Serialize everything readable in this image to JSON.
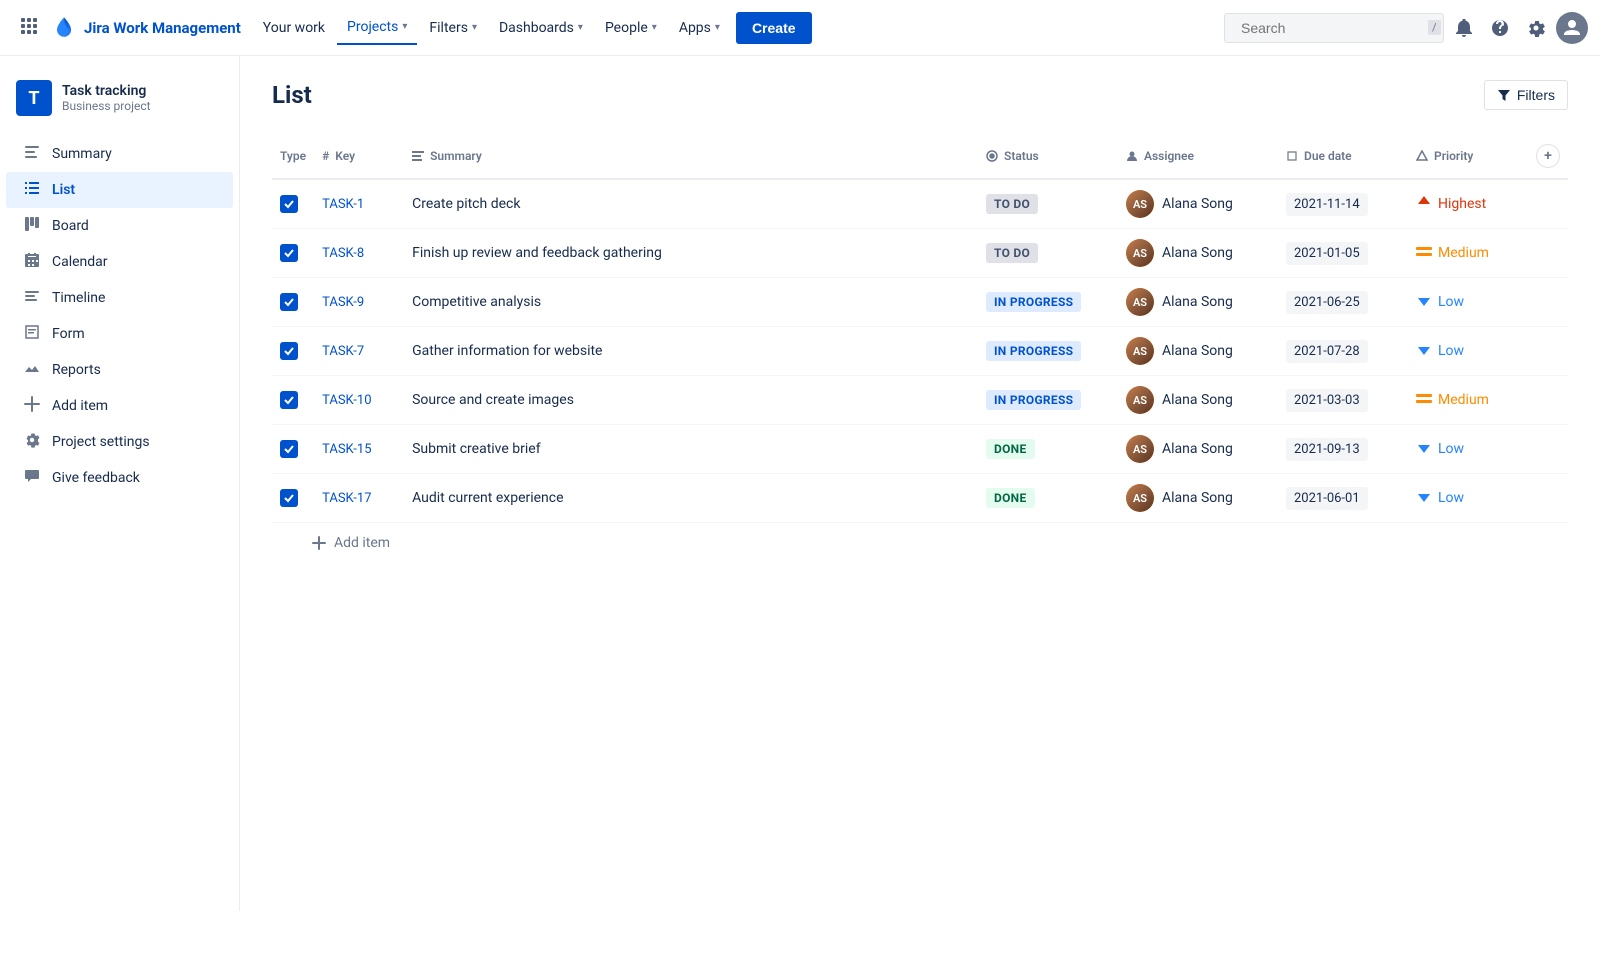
{
  "topnav": {
    "logo_text": "Jira Work Management",
    "your_work": "Your work",
    "projects": "Projects",
    "filters": "Filters",
    "dashboards": "Dashboards",
    "people": "People",
    "apps": "Apps",
    "create": "Create",
    "search_placeholder": "Search",
    "search_shortcut": "/"
  },
  "sidebar": {
    "project_name": "Task tracking",
    "project_type": "Business project",
    "items": [
      {
        "id": "summary",
        "label": "Summary",
        "icon": "▤"
      },
      {
        "id": "list",
        "label": "List",
        "icon": "≡"
      },
      {
        "id": "board",
        "label": "Board",
        "icon": "⊞"
      },
      {
        "id": "calendar",
        "label": "Calendar",
        "icon": "📅"
      },
      {
        "id": "timeline",
        "label": "Timeline",
        "icon": "⊟"
      },
      {
        "id": "form",
        "label": "Form",
        "icon": "📋"
      },
      {
        "id": "reports",
        "label": "Reports",
        "icon": "📈"
      },
      {
        "id": "add-item",
        "label": "Add item",
        "icon": "＋"
      },
      {
        "id": "project-settings",
        "label": "Project settings",
        "icon": "⚙"
      },
      {
        "id": "give-feedback",
        "label": "Give feedback",
        "icon": "📢"
      }
    ]
  },
  "main": {
    "page_title": "List",
    "filters_label": "Filters",
    "columns": [
      {
        "id": "type",
        "label": "Type"
      },
      {
        "id": "key",
        "label": "Key",
        "icon": "#"
      },
      {
        "id": "summary",
        "label": "Summary",
        "icon": "≡"
      },
      {
        "id": "status",
        "label": "Status",
        "icon": "⊙"
      },
      {
        "id": "assignee",
        "label": "Assignee",
        "icon": "@"
      },
      {
        "id": "duedate",
        "label": "Due date",
        "icon": "🏷"
      },
      {
        "id": "priority",
        "label": "Priority",
        "icon": "⊙"
      }
    ],
    "tasks": [
      {
        "key": "TASK-1",
        "summary": "Create pitch deck",
        "status": "TO DO",
        "status_type": "todo",
        "assignee": "Alana Song",
        "due_date": "2021-11-14",
        "priority": "Highest",
        "priority_type": "highest"
      },
      {
        "key": "TASK-8",
        "summary": "Finish up review and feedback gathering",
        "status": "TO DO",
        "status_type": "todo",
        "assignee": "Alana Song",
        "due_date": "2021-01-05",
        "priority": "Medium",
        "priority_type": "medium"
      },
      {
        "key": "TASK-9",
        "summary": "Competitive analysis",
        "status": "IN PROGRESS",
        "status_type": "inprogress",
        "assignee": "Alana Song",
        "due_date": "2021-06-25",
        "priority": "Low",
        "priority_type": "low"
      },
      {
        "key": "TASK-7",
        "summary": "Gather information for website",
        "status": "IN PROGRESS",
        "status_type": "inprogress",
        "assignee": "Alana Song",
        "due_date": "2021-07-28",
        "priority": "Low",
        "priority_type": "low"
      },
      {
        "key": "TASK-10",
        "summary": "Source and create images",
        "status": "IN PROGRESS",
        "status_type": "inprogress",
        "assignee": "Alana Song",
        "due_date": "2021-03-03",
        "priority": "Medium",
        "priority_type": "medium"
      },
      {
        "key": "TASK-15",
        "summary": "Submit creative brief",
        "status": "DONE",
        "status_type": "done",
        "assignee": "Alana Song",
        "due_date": "2021-09-13",
        "priority": "Low",
        "priority_type": "low"
      },
      {
        "key": "TASK-17",
        "summary": "Audit current experience",
        "status": "DONE",
        "status_type": "done",
        "assignee": "Alana Song",
        "due_date": "2021-06-01",
        "priority": "Low",
        "priority_type": "low"
      }
    ],
    "add_item_label": "Add item"
  }
}
